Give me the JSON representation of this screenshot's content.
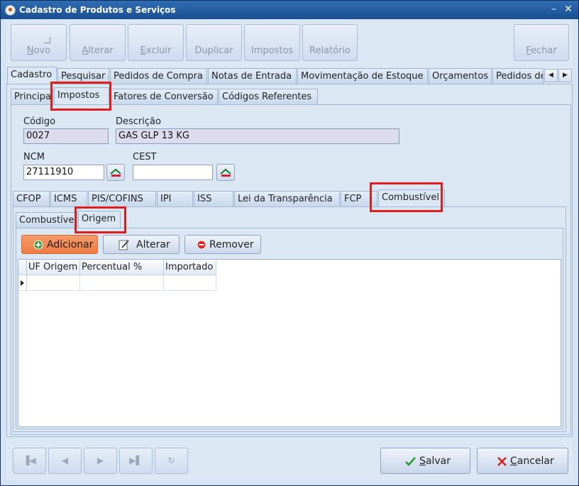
{
  "window": {
    "title": "Cadastro de Produtos e Serviços",
    "minimize": "–",
    "close": "✕"
  },
  "toolbar": {
    "novo": "ovo",
    "novo_u": "N",
    "alterar": "lterar",
    "alterar_u": "A",
    "excluir": "xcluir",
    "excluir_u": "E",
    "duplicar": "Duplicar",
    "impostos": "Impostos",
    "relatorio": "Relatório",
    "fechar": "echar",
    "fechar_u": "F"
  },
  "main_tabs": [
    "Cadastro",
    "Pesquisar",
    "Pedidos de Compra",
    "Notas de Entrada",
    "Movimentação de Estoque",
    "Orçamentos",
    "Pedidos de"
  ],
  "sub_tabs": [
    "Principal",
    "Impostos",
    "Fatores de Conversão",
    "Códigos Referentes"
  ],
  "form": {
    "codigo_label": "Código",
    "codigo_value": "0027",
    "descricao_label": "Descrição",
    "descricao_value": "GAS GLP 13 KG",
    "ncm_label": "NCM",
    "ncm_value": "27111910",
    "cest_label": "CEST",
    "cest_value": ""
  },
  "tax_tabs": [
    "CFOP",
    "ICMS",
    "PIS/COFINS",
    "IPI",
    "ISS",
    "Lei da Transparência",
    "FCP",
    "Combustível"
  ],
  "fuel_tabs": [
    "Combustível",
    "Origem"
  ],
  "actions": {
    "add": "Adicionar",
    "edit": "Alterar",
    "remove": "Remover"
  },
  "grid": {
    "columns": [
      "UF Origem",
      "Percentual %",
      "Importado"
    ]
  },
  "footer": {
    "save": "alvar",
    "save_u": "S",
    "cancel": "ancelar",
    "cancel_u": "C"
  },
  "colors": {
    "highlight": "#e21b1b",
    "add_button": "#ef7a43",
    "title_bar": "#1a4f92"
  }
}
